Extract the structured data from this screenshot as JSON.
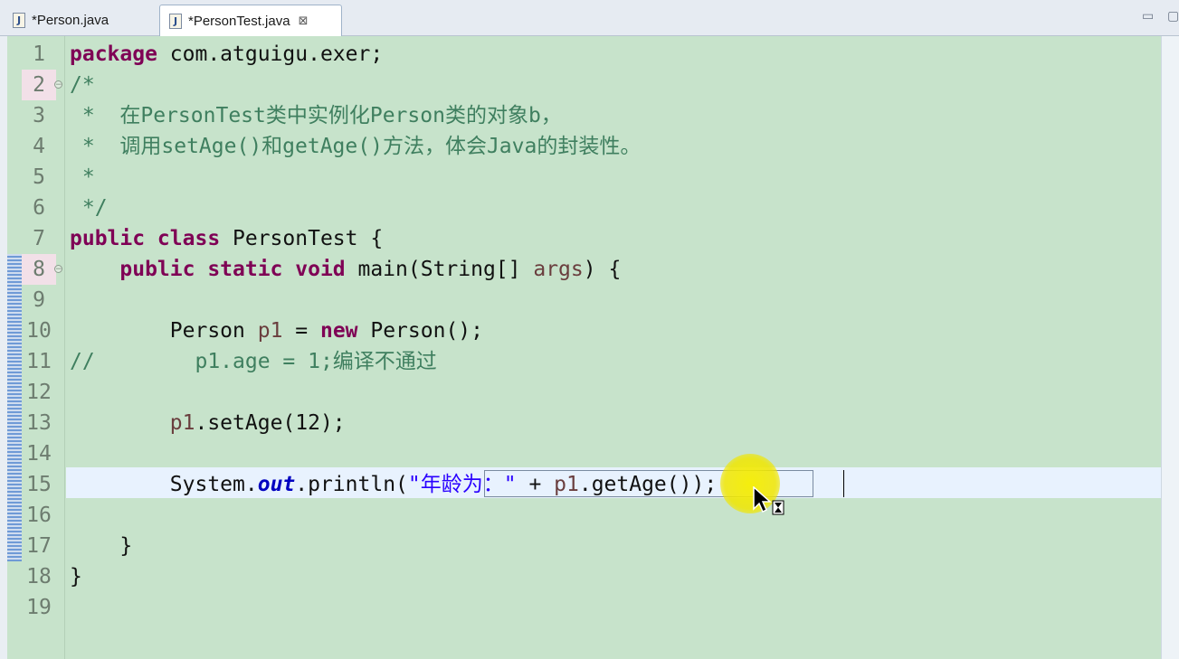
{
  "tabs": [
    {
      "label": "*Person.java",
      "icon": "java-file-icon",
      "active": false
    },
    {
      "label": "*PersonTest.java",
      "icon": "java-file-icon",
      "active": true,
      "close_glyph": "⊠"
    }
  ],
  "window_controls": {
    "minimize": "▭",
    "maximize": "▢"
  },
  "editor": {
    "line_numbers": [
      "1",
      "2",
      "3",
      "4",
      "5",
      "6",
      "7",
      "8",
      "9",
      "10",
      "11",
      "12",
      "13",
      "14",
      "15",
      "16",
      "17",
      "18",
      "19"
    ],
    "code": {
      "l1_kw": "package",
      "l1_rest": " com.atguigu.exer;",
      "l2": "/*",
      "l3": " *  在PersonTest类中实例化Person类的对象b，",
      "l4": " *  调用setAge()和getAge()方法，体会Java的封装性。",
      "l5": " *",
      "l6": " */",
      "l7_kw": "public class",
      "l7_rest": " PersonTest {",
      "l8_indent": "    ",
      "l8_kw": "public static void",
      "l8_rest1": " main(String[] ",
      "l8_var": "args",
      "l8_rest2": ") {",
      "l10_pre": "        Person ",
      "l10_var": "p1",
      "l10_mid": " = ",
      "l10_kw": "new",
      "l10_rest": " Person();",
      "l11": "//        p1.age = 1;编译不通过",
      "l13_pre": "        ",
      "l13_var": "p1",
      "l13_rest": ".setAge(12);",
      "l15_pre": "        System.",
      "l15_field": "out",
      "l15_mid": ".println(",
      "l15_str": "\"年龄为：\"",
      "l15_plus": " + ",
      "l15_var": "p1",
      "l15_rest": ".getAge());",
      "l17": "    }",
      "l18": "}"
    }
  }
}
